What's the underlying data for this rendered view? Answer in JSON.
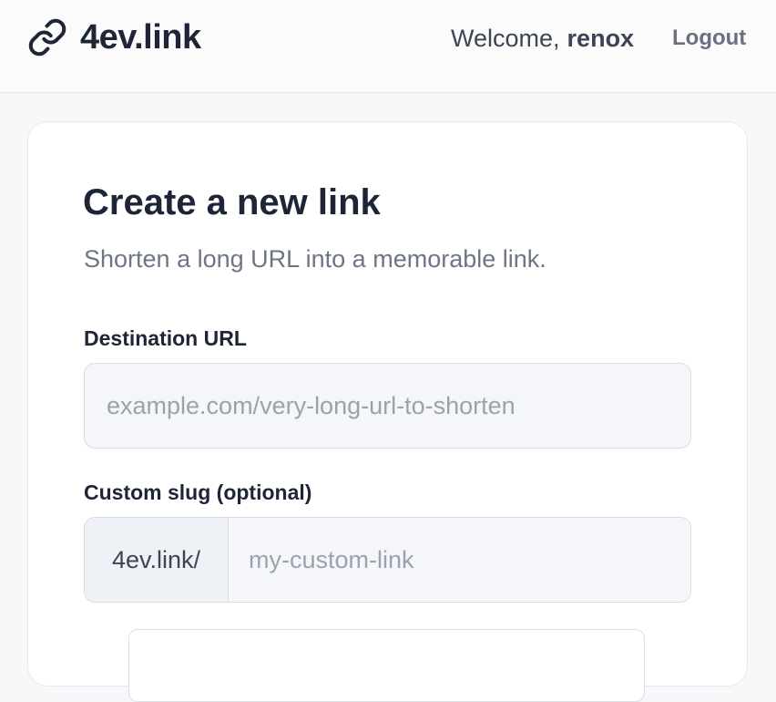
{
  "header": {
    "brand_name": "4ev.link",
    "welcome_prefix": "Welcome,",
    "username": "renox",
    "logout_label": "Logout"
  },
  "form": {
    "title": "Create a new link",
    "subtitle": "Shorten a long URL into a memorable link.",
    "destination": {
      "label": "Destination URL",
      "placeholder": "example.com/very-long-url-to-shorten",
      "value": ""
    },
    "slug": {
      "label": "Custom slug (optional)",
      "prefix": "4ev.link/",
      "placeholder": "my-custom-link",
      "value": ""
    }
  },
  "icons": {
    "brand": "link-icon"
  }
}
